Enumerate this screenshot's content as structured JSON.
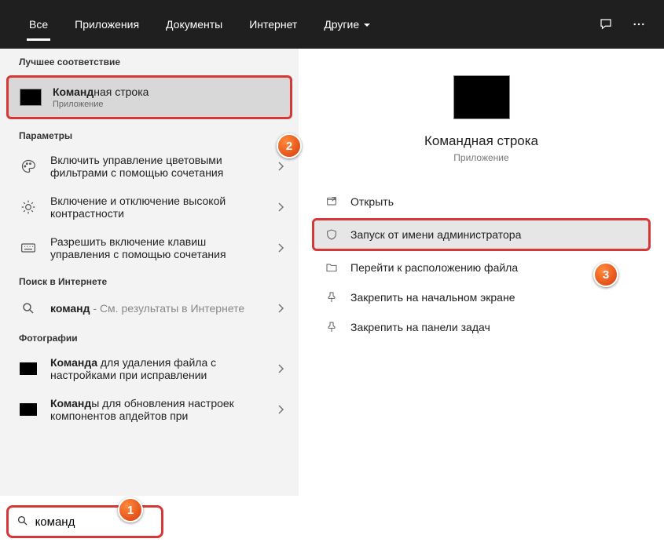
{
  "tabs": {
    "all": "Все",
    "apps": "Приложения",
    "docs": "Документы",
    "web": "Интернет",
    "more": "Другие"
  },
  "sections": {
    "best_match": "Лучшее соответствие",
    "settings": "Параметры",
    "web_search": "Поиск в Интернете",
    "photos": "Фотографии"
  },
  "best_match": {
    "title_bold": "Команд",
    "title_rest": "ная строка",
    "subtitle": "Приложение"
  },
  "settings_items": [
    {
      "line1": "Включить управление цветовыми",
      "line2": "фильтрами с помощью сочетания"
    },
    {
      "line1": "Включение и отключение высокой",
      "line2": "контрастности"
    },
    {
      "line1": "Разрешить включение клавиш",
      "line2": "управления с помощью сочетания"
    }
  ],
  "web_item": {
    "bold": "команд",
    "rest": " - См. результаты в Интернете"
  },
  "photo_items": [
    {
      "bold": "Команда",
      "rest": " для удаления файла с",
      "line2": "настройками при исправлении"
    },
    {
      "bold": "Команд",
      "rest": "ы для обновления настроек",
      "line2": "компонентов апдейтов при"
    }
  ],
  "preview": {
    "title": "Командная строка",
    "subtitle": "Приложение"
  },
  "actions": {
    "open": "Открыть",
    "run_admin": "Запуск от имени администратора",
    "open_location": "Перейти к расположению файла",
    "pin_start": "Закрепить на начальном экране",
    "pin_taskbar": "Закрепить на панели задач"
  },
  "search": {
    "value": "команд"
  },
  "annotations": {
    "b1": "1",
    "b2": "2",
    "b3": "3"
  }
}
